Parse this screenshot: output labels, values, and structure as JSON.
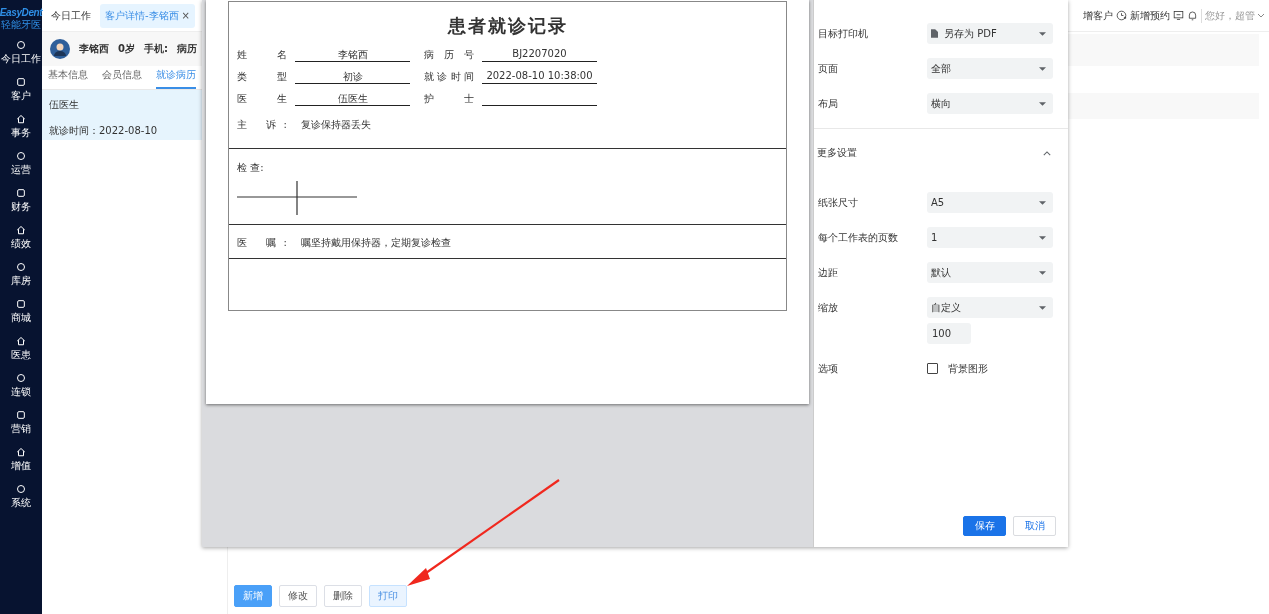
{
  "sidebar": {
    "logo": "EasyDent",
    "logo_subtitle": "轻能牙医",
    "items": [
      {
        "label": "今日工作"
      },
      {
        "label": "客户"
      },
      {
        "label": "事务"
      },
      {
        "label": "运营"
      },
      {
        "label": "财务"
      },
      {
        "label": "绩效"
      },
      {
        "label": "库房"
      },
      {
        "label": "商城"
      },
      {
        "label": "医患"
      },
      {
        "label": "连锁"
      },
      {
        "label": "营销"
      },
      {
        "label": "增值"
      },
      {
        "label": "系统"
      }
    ]
  },
  "tabs": [
    {
      "label": "今日工作",
      "selected": false
    },
    {
      "label": "客户详情-李铭西",
      "selected": true,
      "close": "×"
    }
  ],
  "header": {
    "add_customer": "增客户",
    "add_appointment": "新增预约",
    "greeting": "您好，超管"
  },
  "patient": {
    "name": "李铭西",
    "age": "0岁",
    "phone_label": "手机:",
    "record_label": "病历"
  },
  "subtabs": [
    {
      "label": "基本信息",
      "selected": false
    },
    {
      "label": "会员信息",
      "selected": false
    },
    {
      "label": "就诊病历",
      "selected": true
    }
  ],
  "visits": [
    {
      "doctor": "伍医生",
      "time_label": "就诊时间：",
      "time": "2022-08-10",
      "selected": true
    }
  ],
  "actions": [
    {
      "label": "新增",
      "kind": "primary"
    },
    {
      "label": "修改",
      "kind": "default"
    },
    {
      "label": "删除",
      "kind": "default"
    },
    {
      "label": "打印",
      "kind": "light"
    }
  ],
  "print_dialog": {
    "record": {
      "title": "患者就诊记录",
      "fields": [
        {
          "label": "姓 名",
          "value": "李铭西"
        },
        {
          "label": "病 历 号",
          "value": "BJ2207020"
        },
        {
          "label": "类 型",
          "value": "初诊"
        },
        {
          "label": "就 诊 时 间",
          "value": "2022-08-10 10:38:00"
        },
        {
          "label": "医 生",
          "value": "伍医生"
        },
        {
          "label": "护 士"
        }
      ],
      "complaint": {
        "label": "主 诉:",
        "value": "复诊保持器丢失"
      },
      "exam": {
        "label": "检 查:"
      },
      "advice": {
        "label": "医 嘱:",
        "value": "嘱坚持戴用保持器，定期复诊检查"
      }
    },
    "settings": [
      {
        "label": "目标打印机",
        "value": "另存为 PDF",
        "kind": "file-select"
      },
      {
        "label": "页面",
        "value": "全部",
        "kind": "select"
      },
      {
        "label": "布局",
        "value": "横向",
        "kind": "select"
      }
    ],
    "more_settings": {
      "label": "更多设置",
      "expanded": true
    },
    "more": [
      {
        "label": "纸张尺寸",
        "value": "A5",
        "kind": "select"
      },
      {
        "label": "每个工作表的页数",
        "value": "1",
        "kind": "select"
      },
      {
        "label": "边距",
        "value": "默认",
        "kind": "select"
      },
      {
        "label": "缩放",
        "value": "自定义",
        "kind": "select",
        "extra": "100"
      },
      {
        "label": "选项",
        "value": "背景图形",
        "kind": "checkbox",
        "checked": false
      }
    ],
    "buttons": [
      {
        "label": "保存",
        "kind": "primary"
      },
      {
        "label": "取消",
        "kind": "default"
      }
    ]
  }
}
